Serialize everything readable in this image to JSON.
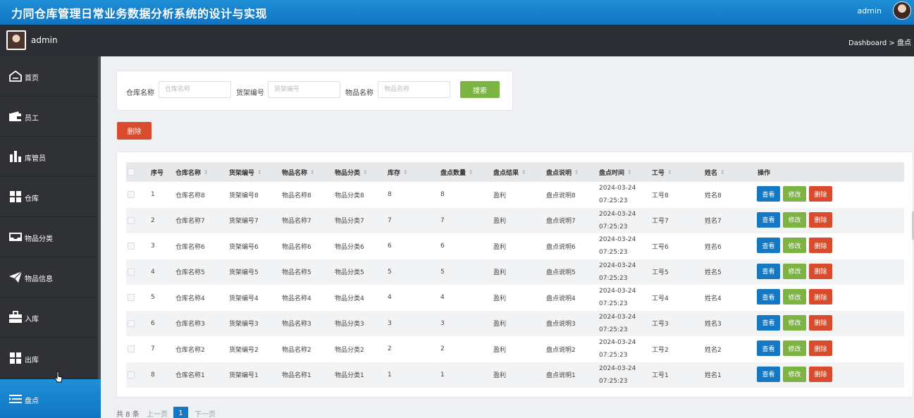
{
  "header": {
    "title": "力同仓库管理日常业务数据分析系统的设计与实现",
    "user": "admin"
  },
  "subheader": {
    "user": "admin",
    "breadcrumb": "Dashboard > 盘点"
  },
  "sidebar": {
    "items": [
      {
        "label": "首页",
        "icon": "home-icon"
      },
      {
        "label": "员工",
        "icon": "wallet-icon"
      },
      {
        "label": "库管员",
        "icon": "bar-chart-icon"
      },
      {
        "label": "仓库",
        "icon": "grid-icon"
      },
      {
        "label": "物品分类",
        "icon": "inbox-icon"
      },
      {
        "label": "物品信息",
        "icon": "paper-plane-icon"
      },
      {
        "label": "入库",
        "icon": "briefcase-icon"
      },
      {
        "label": "出库",
        "icon": "grid-icon"
      },
      {
        "label": "盘点",
        "icon": "list-icon",
        "active": true
      }
    ]
  },
  "search": {
    "warehouse_label": "仓库名称",
    "warehouse_placeholder": "仓库名称",
    "shelf_label": "货架编号",
    "shelf_placeholder": "货架编号",
    "item_label": "物品名称",
    "item_placeholder": "物品名称",
    "button": "搜索"
  },
  "delete_button": "删除",
  "table": {
    "headers": [
      "序号",
      "仓库名称",
      "货架编号",
      "物品名称",
      "物品分类",
      "库存",
      "盘点数量",
      "盘点结果",
      "盘点说明",
      "盘点时间",
      "工号",
      "姓名",
      "操作"
    ],
    "rows": [
      {
        "no": "1",
        "warehouse": "仓库名称8",
        "shelf": "货架编号8",
        "item": "物品名称8",
        "category": "物品分类8",
        "stock": "8",
        "count": "8",
        "result": "盈利",
        "desc": "盘点说明8",
        "time": "2024-03-24 07:25:23",
        "empno": "工号8",
        "name": "姓名8"
      },
      {
        "no": "2",
        "warehouse": "仓库名称7",
        "shelf": "货架编号7",
        "item": "物品名称7",
        "category": "物品分类7",
        "stock": "7",
        "count": "7",
        "result": "盈利",
        "desc": "盘点说明7",
        "time": "2024-03-24 07:25:23",
        "empno": "工号7",
        "name": "姓名7"
      },
      {
        "no": "3",
        "warehouse": "仓库名称6",
        "shelf": "货架编号6",
        "item": "物品名称6",
        "category": "物品分类6",
        "stock": "6",
        "count": "6",
        "result": "盈利",
        "desc": "盘点说明6",
        "time": "2024-03-24 07:25:23",
        "empno": "工号6",
        "name": "姓名6"
      },
      {
        "no": "4",
        "warehouse": "仓库名称5",
        "shelf": "货架编号5",
        "item": "物品名称5",
        "category": "物品分类5",
        "stock": "5",
        "count": "5",
        "result": "盈利",
        "desc": "盘点说明5",
        "time": "2024-03-24 07:25:23",
        "empno": "工号5",
        "name": "姓名5"
      },
      {
        "no": "5",
        "warehouse": "仓库名称4",
        "shelf": "货架编号4",
        "item": "物品名称4",
        "category": "物品分类4",
        "stock": "4",
        "count": "4",
        "result": "盈利",
        "desc": "盘点说明4",
        "time": "2024-03-24 07:25:23",
        "empno": "工号4",
        "name": "姓名4"
      },
      {
        "no": "6",
        "warehouse": "仓库名称3",
        "shelf": "货架编号3",
        "item": "物品名称3",
        "category": "物品分类3",
        "stock": "3",
        "count": "3",
        "result": "盈利",
        "desc": "盘点说明3",
        "time": "2024-03-24 07:25:23",
        "empno": "工号3",
        "name": "姓名3"
      },
      {
        "no": "7",
        "warehouse": "仓库名称2",
        "shelf": "货架编号2",
        "item": "物品名称2",
        "category": "物品分类2",
        "stock": "2",
        "count": "2",
        "result": "盈利",
        "desc": "盘点说明2",
        "time": "2024-03-24 07:25:23",
        "empno": "工号2",
        "name": "姓名2"
      },
      {
        "no": "8",
        "warehouse": "仓库名称1",
        "shelf": "货架编号1",
        "item": "物品名称1",
        "category": "物品分类1",
        "stock": "1",
        "count": "1",
        "result": "盈利",
        "desc": "盘点说明1",
        "time": "2024-03-24 07:25:23",
        "empno": "工号1",
        "name": "姓名1"
      }
    ],
    "actions": {
      "view": "查看",
      "edit": "修改",
      "delete": "删除"
    }
  },
  "pagination": {
    "total": "共 8 条",
    "prev": "上一页",
    "current": "1",
    "next": "下一页"
  },
  "colors": {
    "primary": "#1678c2",
    "success": "#7cb342",
    "danger": "#d84c2d",
    "sidebar": "#2f3135"
  }
}
